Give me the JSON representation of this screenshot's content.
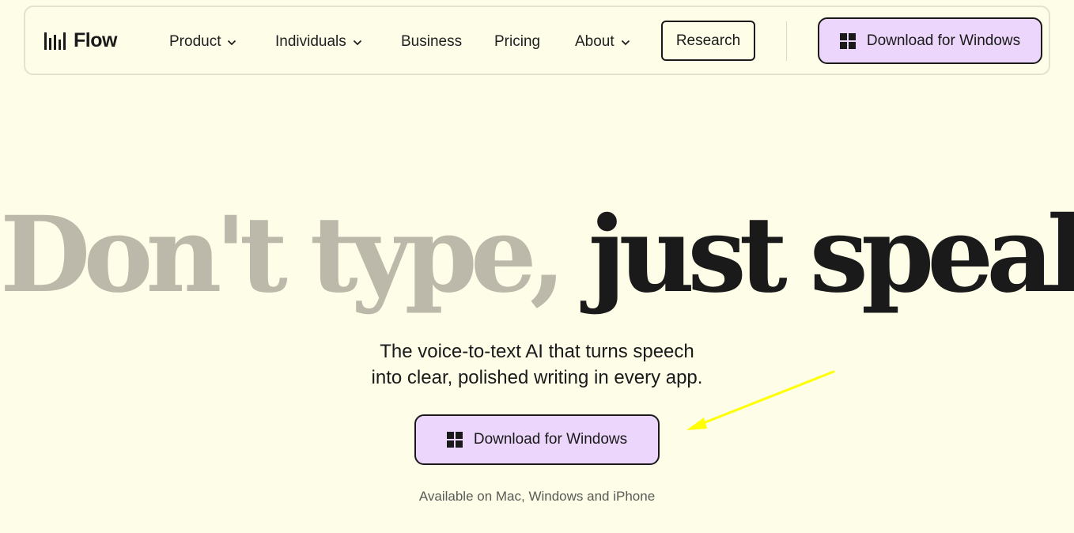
{
  "header": {
    "logo_text": "Flow",
    "nav": {
      "product": "Product",
      "individuals": "Individuals",
      "business": "Business",
      "pricing": "Pricing",
      "about": "About",
      "research": "Research"
    },
    "download_label": "Download for Windows"
  },
  "hero": {
    "title_muted": "Don't type,",
    "title_strong": "just speak",
    "subtitle_line1": "The voice-to-text AI that turns speech",
    "subtitle_line2": "into clear, polished writing in every app.",
    "download_label": "Download for Windows",
    "availability": "Available on Mac, Windows and iPhone"
  },
  "icons": {
    "logo": "audio-bars-icon",
    "dropdown": "chevron-down-icon",
    "windows": "windows-logo-icon",
    "annotation": "arrow-icon"
  },
  "colors": {
    "background": "#fefde8",
    "button_fill": "#ecd6fb",
    "title_muted": "#bcb8aa",
    "annotation_arrow": "#ffff00"
  }
}
